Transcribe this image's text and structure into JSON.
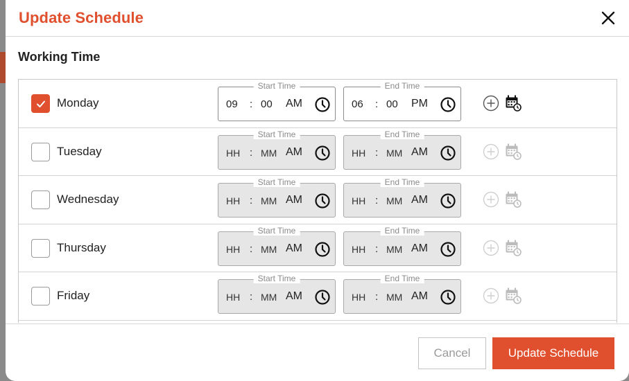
{
  "modal": {
    "title": "Update Schedule",
    "section_title": "Working Time"
  },
  "legend": {
    "start": "Start Time",
    "end": "End Time"
  },
  "days": [
    {
      "label": "Monday",
      "checked": true,
      "start": {
        "hh": "09",
        "mm": "00",
        "ampm": "AM"
      },
      "end": {
        "hh": "06",
        "mm": "00",
        "ampm": "PM"
      }
    },
    {
      "label": "Tuesday",
      "checked": false,
      "start": {
        "hh": "HH",
        "mm": "MM",
        "ampm": "AM"
      },
      "end": {
        "hh": "HH",
        "mm": "MM",
        "ampm": "AM"
      }
    },
    {
      "label": "Wednesday",
      "checked": false,
      "start": {
        "hh": "HH",
        "mm": "MM",
        "ampm": "AM"
      },
      "end": {
        "hh": "HH",
        "mm": "MM",
        "ampm": "AM"
      }
    },
    {
      "label": "Thursday",
      "checked": false,
      "start": {
        "hh": "HH",
        "mm": "MM",
        "ampm": "AM"
      },
      "end": {
        "hh": "HH",
        "mm": "MM",
        "ampm": "AM"
      }
    },
    {
      "label": "Friday",
      "checked": false,
      "start": {
        "hh": "HH",
        "mm": "MM",
        "ampm": "AM"
      },
      "end": {
        "hh": "HH",
        "mm": "MM",
        "ampm": "AM"
      }
    }
  ],
  "colon": ":",
  "footer": {
    "cancel_label": "Cancel",
    "update_label": "Update Schedule"
  },
  "colors": {
    "accent": "#e0502e"
  },
  "icons": {
    "close": "close-icon",
    "clock": "clock-icon",
    "add": "add-circle-icon",
    "calendar": "calendar-clock-icon",
    "check": "check-icon"
  }
}
